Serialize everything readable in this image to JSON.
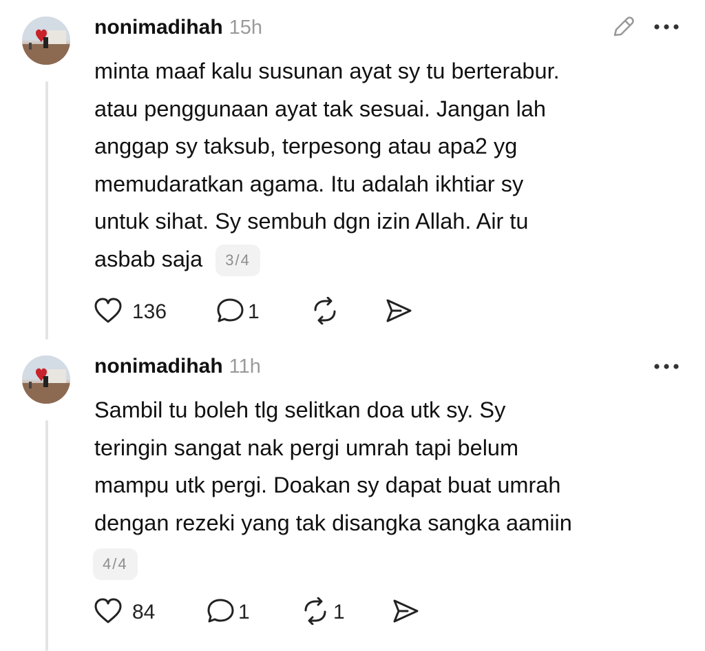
{
  "posts": [
    {
      "username": "nonimadihah",
      "time": "15h",
      "lines": [
        "minta maaf kalu susunan ayat sy tu berterabur.",
        "atau penggunaan ayat tak sesuai. Jangan lah",
        "anggap sy taksub, terpesong atau apa2 yg",
        "memudaratkan agama. Itu adalah ikhtiar sy",
        "untuk sihat. Sy sembuh dgn izin Allah. Air tu",
        "asbab saja"
      ],
      "pager": "3/4",
      "likes": "136",
      "replies": "1",
      "reposts": "",
      "icons": [
        "edit-icon",
        "more-icon",
        "heart-icon",
        "reply-icon",
        "repost-icon",
        "share-icon"
      ]
    },
    {
      "username": "nonimadihah",
      "time": "11h",
      "lines": [
        "Sambil tu boleh tlg selitkan doa utk sy. Sy",
        "teringin sangat nak pergi umrah tapi belum",
        "mampu utk pergi. Doakan sy dapat buat umrah",
        "dengan rezeki yang tak disangka sangka aamiin"
      ],
      "pager": "4/4",
      "likes": "84",
      "replies": "1",
      "reposts": "1",
      "icons": [
        "more-icon",
        "heart-icon",
        "reply-icon",
        "repost-icon",
        "share-icon"
      ]
    }
  ],
  "colors": {
    "text": "#111111",
    "muted": "#9a9a9a",
    "thread_line": "#e4e4e4",
    "pager_bg": "#f2f2f2"
  }
}
